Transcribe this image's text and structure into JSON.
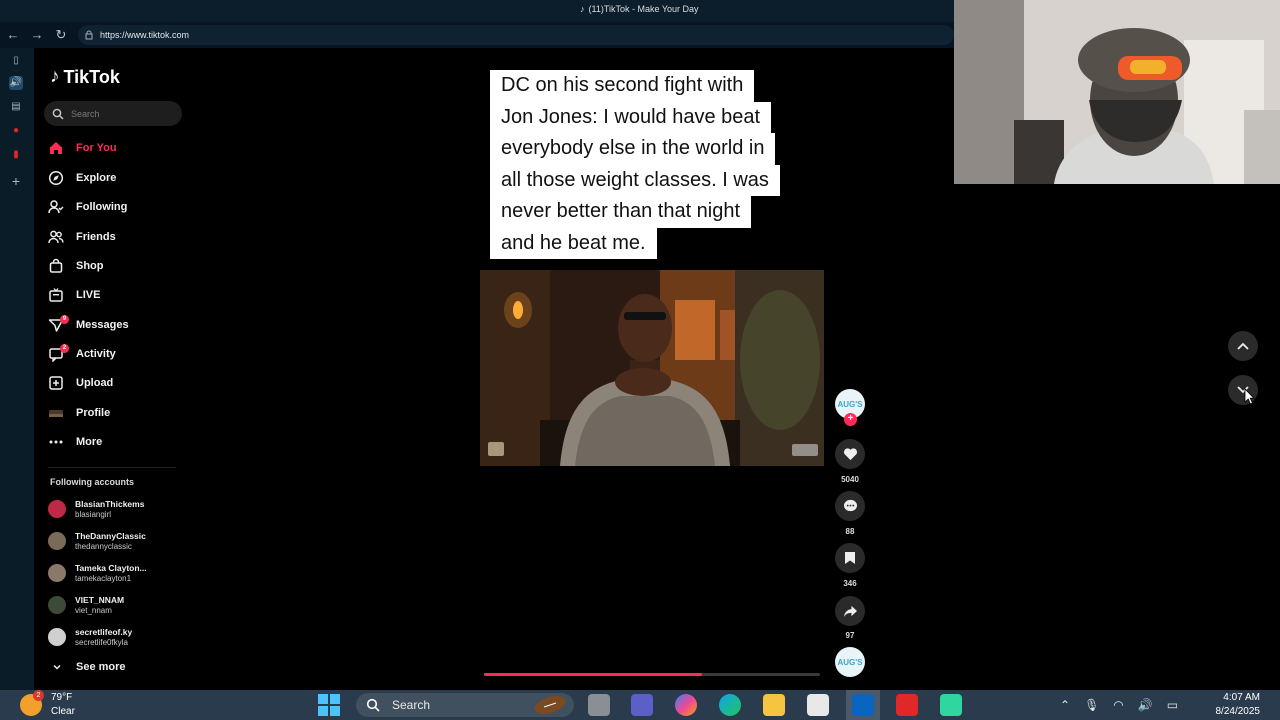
{
  "browser": {
    "tab_title": "(11)TikTok - Make Your Day",
    "url": "https://www.tiktok.com"
  },
  "sidebar": {
    "logo": "TikTok",
    "search_placeholder": "Search",
    "nav": [
      {
        "label": "For You",
        "icon": "home-icon",
        "active": true
      },
      {
        "label": "Explore",
        "icon": "compass-icon"
      },
      {
        "label": "Following",
        "icon": "following-icon"
      },
      {
        "label": "Friends",
        "icon": "friends-icon"
      },
      {
        "label": "Shop",
        "icon": "shop-icon"
      },
      {
        "label": "LIVE",
        "icon": "live-icon"
      },
      {
        "label": "Messages",
        "icon": "messages-icon",
        "badge": "9"
      },
      {
        "label": "Activity",
        "icon": "activity-icon",
        "badge": "2"
      },
      {
        "label": "Upload",
        "icon": "upload-icon"
      },
      {
        "label": "Profile",
        "icon": "profile-avatar"
      },
      {
        "label": "More",
        "icon": "more-icon"
      }
    ],
    "following_header": "Following accounts",
    "accounts": [
      {
        "name": "BlasianThickems",
        "handle": "blasiangirl",
        "color": "#c02848"
      },
      {
        "name": "TheDannyClassic",
        "handle": "thedannyclassic",
        "color": "#7a6a58"
      },
      {
        "name": "Tameka Clayton...",
        "handle": "tamekaclayton1",
        "color": "#8a7868"
      },
      {
        "name": "VIET_NNAM",
        "handle": "viet_nnam",
        "color": "#3e4a38"
      },
      {
        "name": "secretlifeof.ky",
        "handle": "secretlife0fkyla",
        "color": "#d0d0d0"
      }
    ],
    "see_more": "See more"
  },
  "video": {
    "caption_lines": [
      "DC on his second fight with",
      "Jon Jones: I would have beat",
      "everybody else in the world in",
      "all those weight classes. I was",
      "never better than that night",
      "and he beat me."
    ],
    "progress": 0.65
  },
  "actions": {
    "creator_label": "AUG'S",
    "likes": "5040",
    "comments": "88",
    "saves": "346",
    "shares": "97"
  },
  "taskbar": {
    "weather_badge": "2",
    "temperature": "79°F",
    "condition": "Clear",
    "search_label": "Search",
    "time": "4:07 AM",
    "date": "8/24/2025"
  }
}
